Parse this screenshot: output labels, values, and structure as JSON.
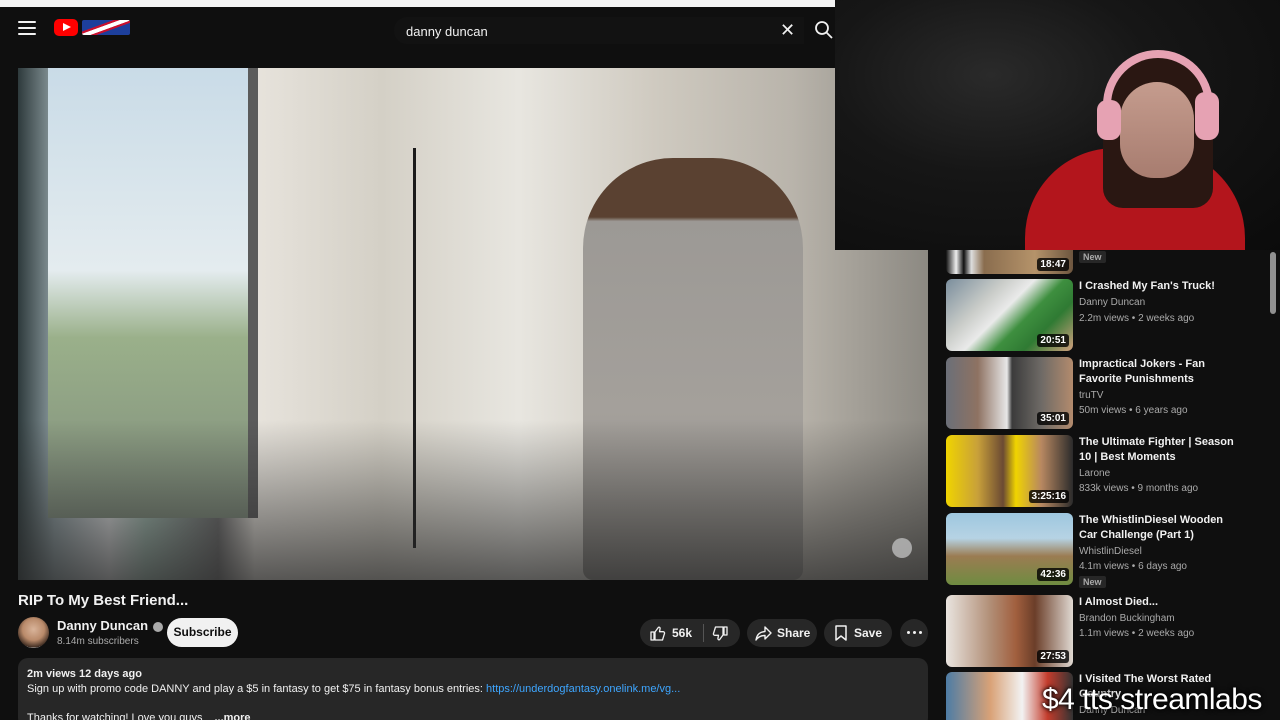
{
  "header": {
    "search_value": "danny duncan"
  },
  "video": {
    "title": "RIP To My Best Friend...",
    "channel": "Danny Duncan",
    "subscribers": "8.14m subscribers",
    "subscribe_label": "Subscribe",
    "likes": "56k",
    "share_label": "Share",
    "save_label": "Save",
    "views_date": "2m views  12 days ago",
    "description_text": "Sign up with promo code DANNY and play a $5 in fantasy to get $75 in fantasy bonus entries: ",
    "description_link": "https://underdogfantasy.onelink.me/vg...",
    "description_line2": "Thanks for watching! Love you guys",
    "more_label": "...more"
  },
  "sidebar": {
    "top_item": {
      "duration": "18:47",
      "badge": "New"
    },
    "items": [
      {
        "title": "I Crashed My Fan's Truck!",
        "channel": "Danny Duncan",
        "meta": "2.2m views • 2 weeks ago",
        "duration": "20:51"
      },
      {
        "title": "Impractical Jokers - Fan Favorite Punishments (Mashu...",
        "channel": "truTV",
        "meta": "50m views • 6 years ago",
        "duration": "35:01"
      },
      {
        "title": "The Ultimate Fighter | Season 10 | Best Moments",
        "channel": "Larone",
        "meta": "833k views • 9 months ago",
        "duration": "3:25:16"
      },
      {
        "title": "The WhistlinDiesel Wooden Car Challenge (Part 1)",
        "channel": "WhistlinDiesel",
        "meta": "4.1m views • 6 days ago",
        "duration": "42:36",
        "badge": "New"
      },
      {
        "title": "I Almost Died...",
        "channel": "Brandon Buckingham",
        "meta": "1.1m views • 2 weeks ago",
        "duration": "27:53"
      },
      {
        "title": "I Visited The Worst Rated Country",
        "channel": "Danny Duncan",
        "meta": "",
        "duration": ""
      }
    ]
  },
  "overlay": {
    "text": "$4 tts streamlabs"
  }
}
